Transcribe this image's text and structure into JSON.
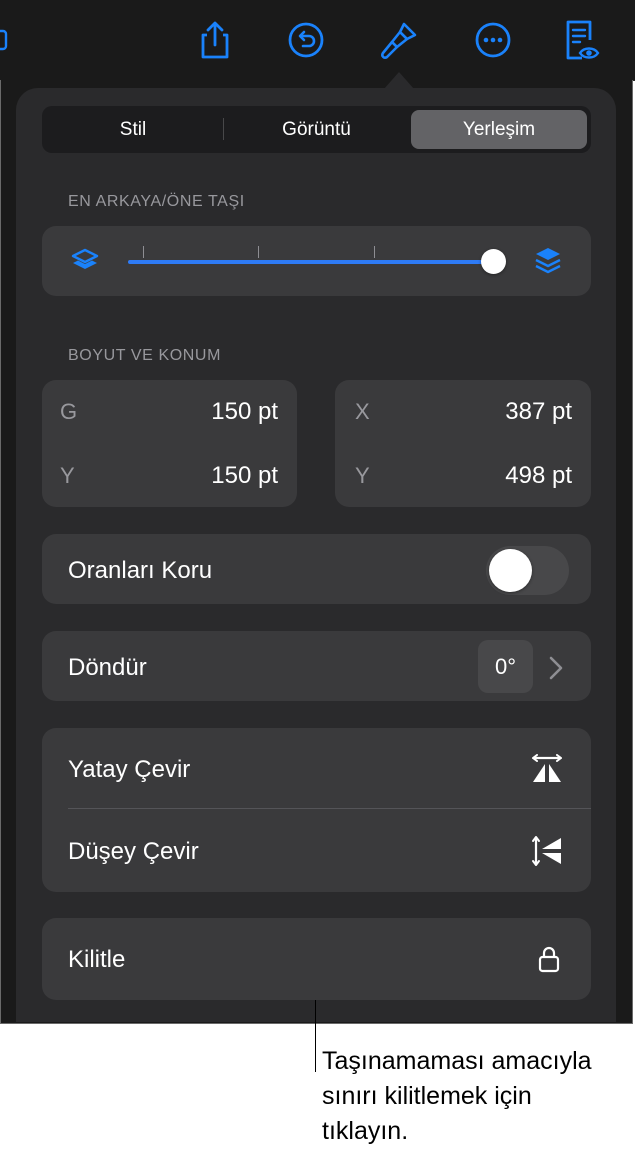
{
  "toolbar": {
    "buttons": [
      {
        "icon": "share-icon"
      },
      {
        "icon": "undo-icon"
      },
      {
        "icon": "format-brush-icon"
      },
      {
        "icon": "more-icon"
      },
      {
        "icon": "document-view-icon"
      }
    ],
    "accent": "#1a82fb"
  },
  "tabs": [
    {
      "label": "Stil",
      "active": false
    },
    {
      "label": "Görüntü",
      "active": false
    },
    {
      "label": "Yerleşim",
      "active": true
    }
  ],
  "arrange": {
    "title": "EN ARKAYA/ÖNE TAŞI",
    "slider_value_fraction": 1.0,
    "left_icon": "send-backward-icon",
    "right_icon": "bring-forward-icon"
  },
  "size_position": {
    "title": "BOYUT VE KONUM",
    "size": {
      "width_label": "G",
      "width_value": "150 pt",
      "height_label": "Y",
      "height_value": "150 pt"
    },
    "position": {
      "x_label": "X",
      "x_value": "387 pt",
      "y_label": "Y",
      "y_value": "498 pt"
    }
  },
  "constrain": {
    "label": "Oranları Koru",
    "on": false
  },
  "rotate": {
    "label": "Döndür",
    "value": "0°"
  },
  "flip": {
    "horizontal_label": "Yatay Çevir",
    "vertical_label": "Düşey Çevir"
  },
  "lock": {
    "label": "Kilitle"
  },
  "callout": {
    "lines": [
      "Taşınamaması amacıyla",
      "sınırı kilitlemek için",
      "tıklayın."
    ]
  },
  "colors": {
    "panel": "#2a2a2c",
    "card": "#3a3a3c",
    "accent_blue": "#2e7bf6"
  }
}
